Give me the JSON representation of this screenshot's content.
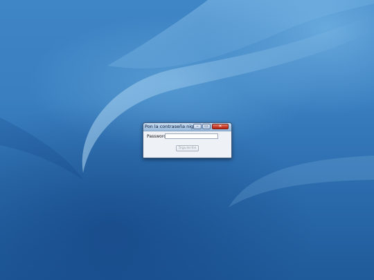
{
  "desktop": {
    "accent_color": "#2e6fae"
  },
  "dialog": {
    "title": "Pon la contraseña nigga",
    "minimize_glyph": "–",
    "maximize_glyph": "▭",
    "close_glyph": "✕",
    "password_label": "Password:",
    "password_value": "",
    "password_placeholder": "",
    "next_button_label": "Siguiente",
    "next_button_enabled": false,
    "close_color": "#c83a24"
  },
  "icons": {
    "minimize": "minimize-icon",
    "maximize": "maximize-icon",
    "close": "close-icon"
  }
}
